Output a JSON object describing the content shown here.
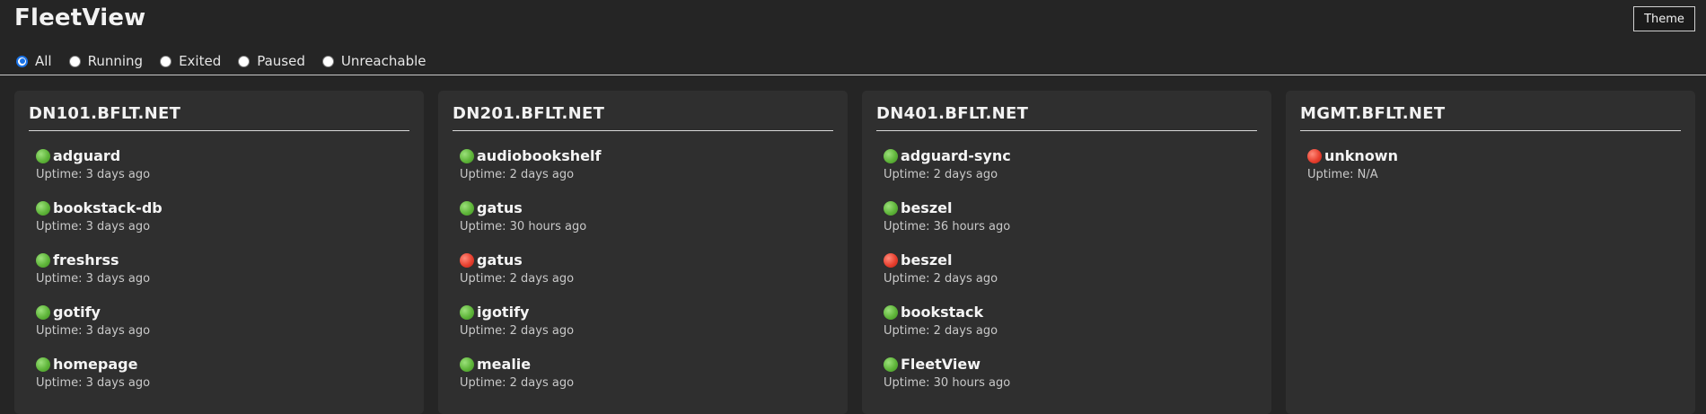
{
  "app": {
    "title": "FleetView",
    "theme_label": "Theme"
  },
  "filters": [
    {
      "label": "All",
      "checked": true
    },
    {
      "label": "Running",
      "checked": false
    },
    {
      "label": "Exited",
      "checked": false
    },
    {
      "label": "Paused",
      "checked": false
    },
    {
      "label": "Unreachable",
      "checked": false
    }
  ],
  "status_colors": {
    "running": "#5fb53a",
    "stopped": "#e8402f"
  },
  "hosts": [
    {
      "name": "DN101.BFLT.NET",
      "containers": [
        {
          "status": "running",
          "name": "adguard",
          "uptime": "Uptime: 3 days ago"
        },
        {
          "status": "running",
          "name": "bookstack-db",
          "uptime": "Uptime: 3 days ago"
        },
        {
          "status": "running",
          "name": "freshrss",
          "uptime": "Uptime: 3 days ago"
        },
        {
          "status": "running",
          "name": "gotify",
          "uptime": "Uptime: 3 days ago"
        },
        {
          "status": "running",
          "name": "homepage",
          "uptime": "Uptime: 3 days ago"
        }
      ]
    },
    {
      "name": "DN201.BFLT.NET",
      "containers": [
        {
          "status": "running",
          "name": "audiobookshelf",
          "uptime": "Uptime: 2 days ago"
        },
        {
          "status": "running",
          "name": "gatus",
          "uptime": "Uptime: 30 hours ago"
        },
        {
          "status": "stopped",
          "name": "gatus",
          "uptime": "Uptime: 2 days ago"
        },
        {
          "status": "running",
          "name": "igotify",
          "uptime": "Uptime: 2 days ago"
        },
        {
          "status": "running",
          "name": "mealie",
          "uptime": "Uptime: 2 days ago"
        }
      ]
    },
    {
      "name": "DN401.BFLT.NET",
      "containers": [
        {
          "status": "running",
          "name": "adguard-sync",
          "uptime": "Uptime: 2 days ago"
        },
        {
          "status": "running",
          "name": "beszel",
          "uptime": "Uptime: 36 hours ago"
        },
        {
          "status": "stopped",
          "name": "beszel",
          "uptime": "Uptime: 2 days ago"
        },
        {
          "status": "running",
          "name": "bookstack",
          "uptime": "Uptime: 2 days ago"
        },
        {
          "status": "running",
          "name": "FleetView",
          "uptime": "Uptime: 30 hours ago"
        }
      ]
    },
    {
      "name": "MGMT.BFLT.NET",
      "containers": [
        {
          "status": "stopped",
          "name": "unknown",
          "uptime": "Uptime: N/A"
        }
      ]
    }
  ]
}
